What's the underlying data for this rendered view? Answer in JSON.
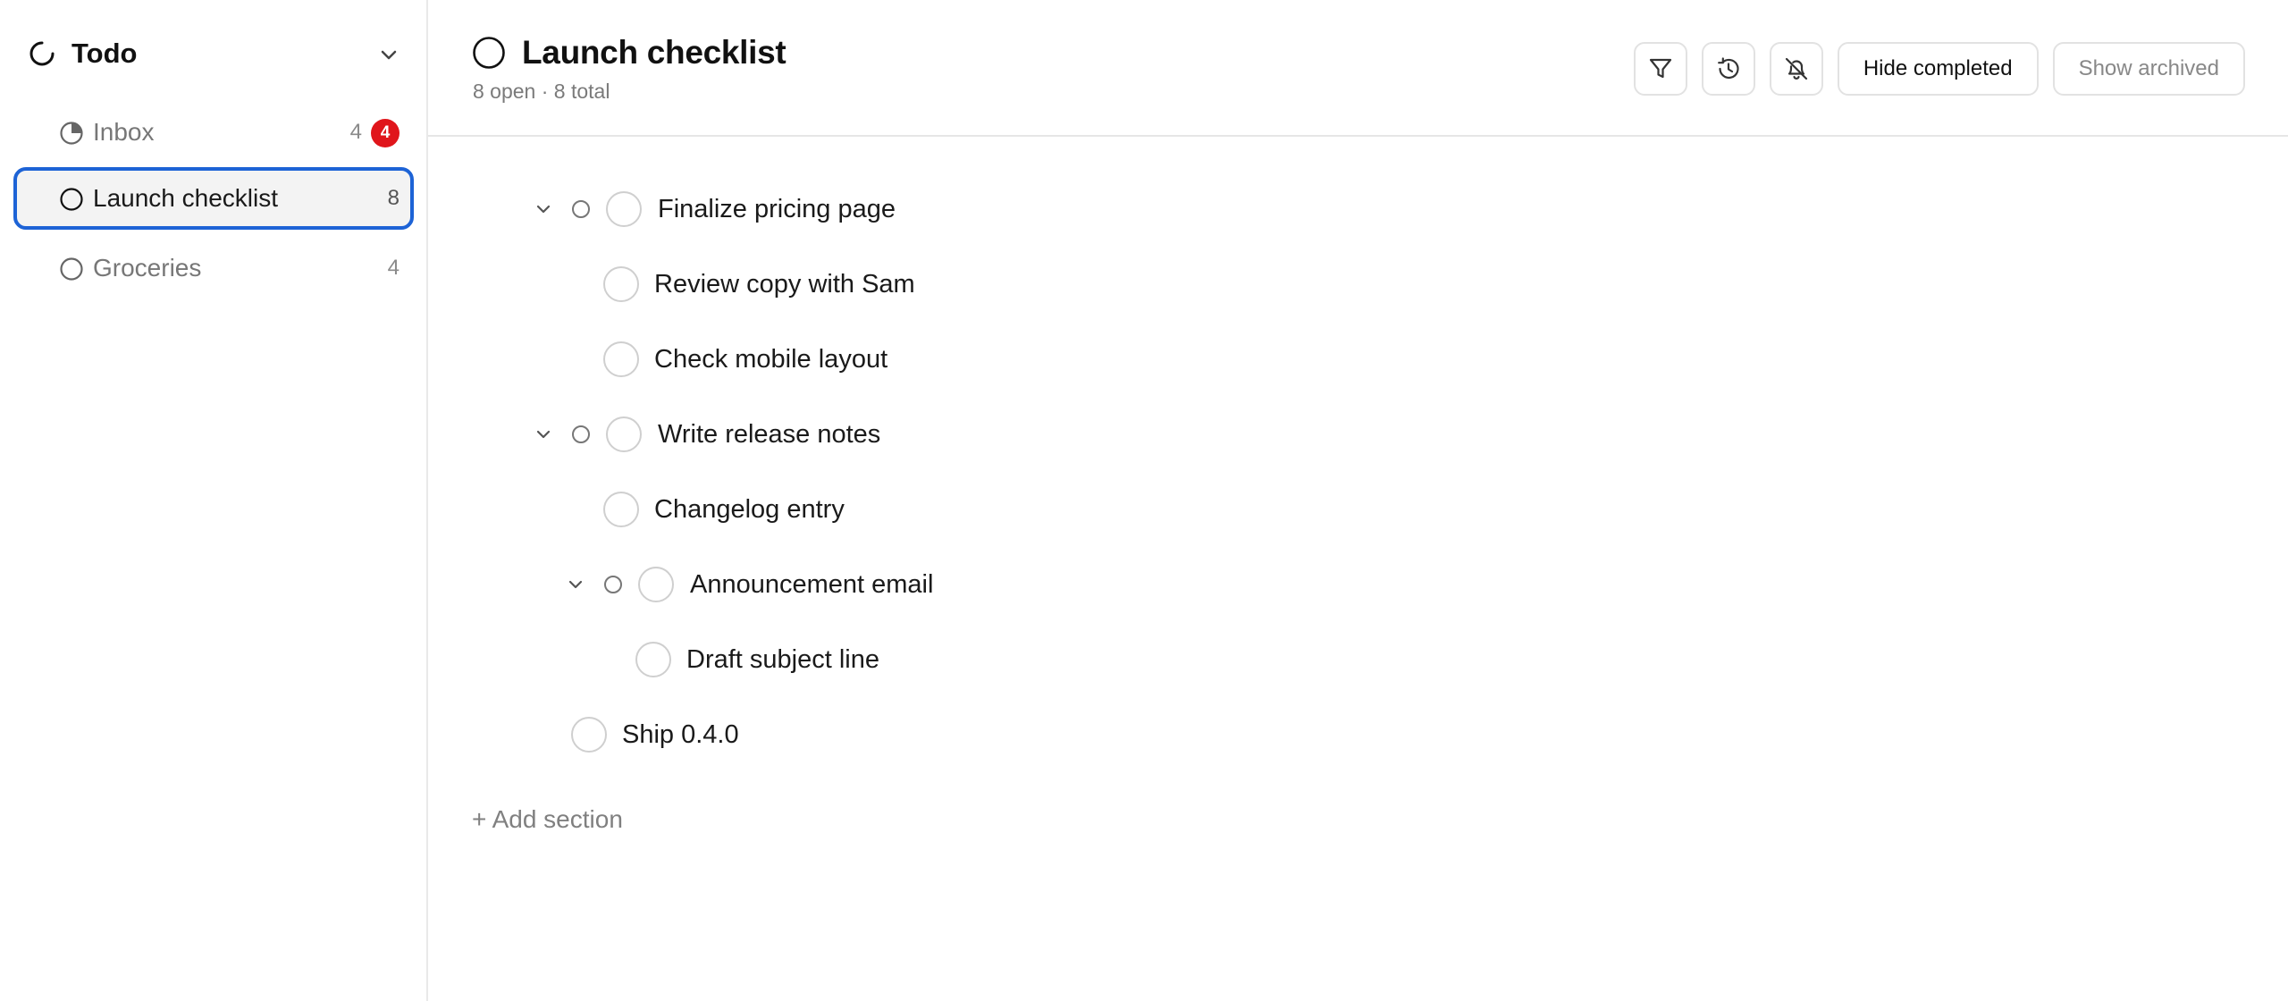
{
  "sidebar": {
    "workspace_title": "Todo",
    "items": [
      {
        "label": "Inbox",
        "count": "4",
        "badge": "4"
      },
      {
        "label": "Launch checklist",
        "count": "8"
      },
      {
        "label": "Groceries",
        "count": "4"
      }
    ]
  },
  "header": {
    "title": "Launch checklist",
    "subtitle": "8 open · 8 total",
    "toolbar": {
      "filter_icon": "filter-icon",
      "history_icon": "history-icon",
      "mute_icon": "bell-off-icon",
      "hide_completed": "Hide completed",
      "show_archived": "Show archived"
    }
  },
  "tasks": [
    {
      "label": "Finalize pricing page",
      "level": 0,
      "has_children": true,
      "expanded": true
    },
    {
      "label": "Review copy with Sam",
      "level": 1
    },
    {
      "label": "Check mobile layout",
      "level": 1
    },
    {
      "label": "Write release notes",
      "level": 0,
      "has_children": true,
      "expanded": true
    },
    {
      "label": "Changelog entry",
      "level": 1
    },
    {
      "label": "Announcement email",
      "level": 1,
      "has_children": true,
      "expanded": true
    },
    {
      "label": "Draft subject line",
      "level": 2
    },
    {
      "label": "Ship 0.4.0",
      "level": 0
    }
  ],
  "add_section_label": "+ Add section",
  "colors": {
    "accent": "#1d63d6",
    "badge": "#e0151b",
    "muted_text": "#7a7a7a",
    "border": "#e2e2e2"
  }
}
